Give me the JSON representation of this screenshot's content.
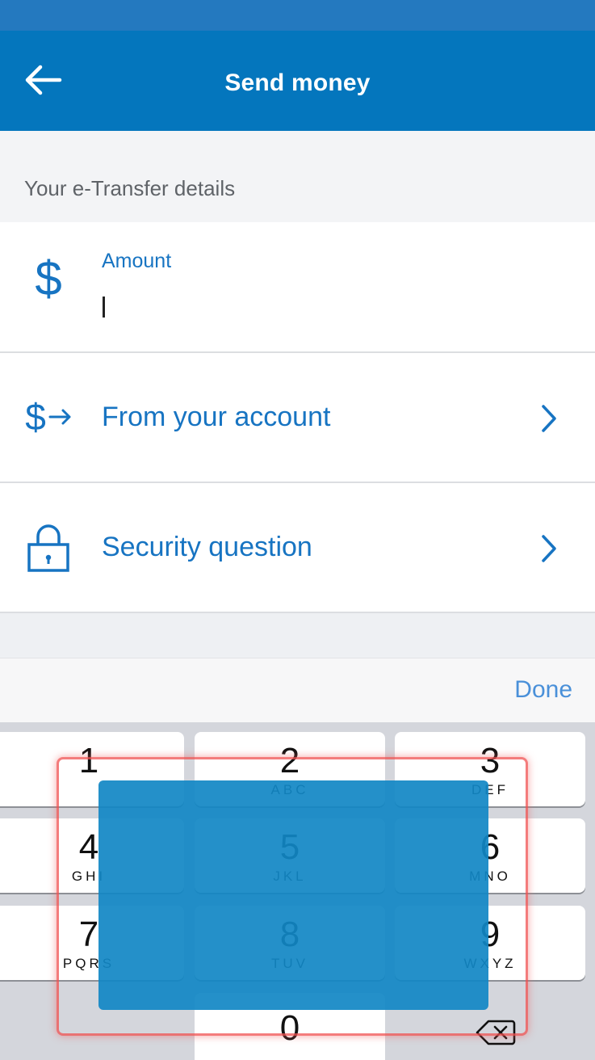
{
  "header": {
    "title": "Send money",
    "back_icon": "arrow-left-icon"
  },
  "section": {
    "title": "Your e-Transfer details"
  },
  "amount": {
    "label": "Amount",
    "value": "",
    "placeholder": "",
    "icon": "dollar-icon"
  },
  "from_account": {
    "label": "From your account",
    "icon": "dollar-arrow-icon"
  },
  "security_question": {
    "label": "Security question",
    "icon": "lock-icon"
  },
  "keyboard": {
    "done_label": "Done",
    "keys": [
      {
        "digit": "1",
        "letters": ""
      },
      {
        "digit": "2",
        "letters": "ABC"
      },
      {
        "digit": "3",
        "letters": "DEF"
      },
      {
        "digit": "4",
        "letters": "GHI"
      },
      {
        "digit": "5",
        "letters": "JKL"
      },
      {
        "digit": "6",
        "letters": "MNO"
      },
      {
        "digit": "7",
        "letters": "PQRS"
      },
      {
        "digit": "8",
        "letters": "TUV"
      },
      {
        "digit": "9",
        "letters": "WXYZ"
      },
      {
        "digit": "0",
        "letters": ""
      }
    ],
    "delete_icon": "backspace-icon"
  },
  "colors": {
    "app_bar": "#0476bd",
    "status_bar": "#2479bf",
    "accent": "#1774c2",
    "done": "#4a90d9",
    "highlight_fill": "#1187c4",
    "highlight_border": "#f05050"
  }
}
